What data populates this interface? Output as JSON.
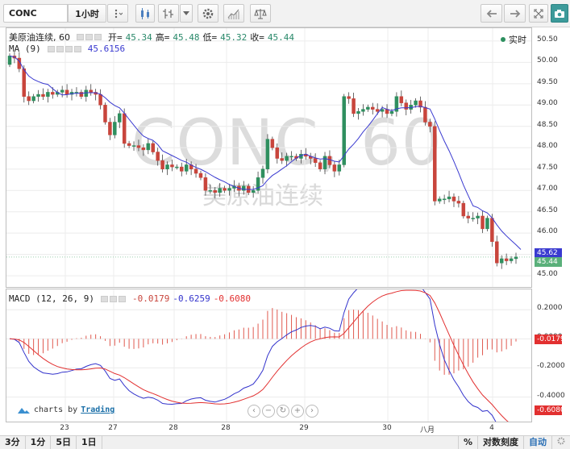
{
  "toolbar": {
    "symbol": "CONC",
    "interval": "1小时",
    "icons": [
      "menu-dots-icon",
      "candles-icon",
      "bar-style-icon",
      "settings-icon",
      "indicator-icon",
      "compare-icon",
      "undo-icon",
      "redo-icon",
      "fullscreen-icon",
      "camera-icon"
    ]
  },
  "legend": {
    "name": "美原油连续, 60",
    "open_label": "开=",
    "open": "45.34",
    "high_label": "高=",
    "high": "45.48",
    "low_label": "低=",
    "low": "45.32",
    "close_label": "收=",
    "close": "45.44",
    "ma_label": "MA (9)",
    "ma_value": "45.6156",
    "macd_label": "MACD (12, 26, 9)",
    "macd_hist": "-0.0179",
    "macd_line": "-0.6259",
    "macd_signal": "-0.6080"
  },
  "live_label": "实时",
  "watermark": {
    "main": "CONC, 60",
    "sub": "美原油连续"
  },
  "price_tags": {
    "ma": "45.62",
    "last": "45.44",
    "hist": "-0.0179",
    "signal": "-0.6080"
  },
  "credit": {
    "prefix": "charts by",
    "brand": "Trading"
  },
  "bottom": {
    "left": [
      "3分",
      "1分",
      "5日",
      "1日"
    ],
    "percent": "%",
    "log": "对数刻度",
    "auto": "自动"
  },
  "colors": {
    "up": "#2f8f5f",
    "down": "#c8453c",
    "ma": "#3a3ad0",
    "macd": "#3333cc",
    "signal": "#e23030"
  },
  "chart_data": [
    {
      "type": "candlestick",
      "name": "美原油连续, 60",
      "ylim": [
        44.7,
        50.8
      ],
      "y_ticks": [
        45.0,
        45.5,
        46.0,
        46.5,
        47.0,
        47.5,
        48.0,
        48.5,
        49.0,
        49.5,
        50.0,
        50.5
      ],
      "x_ticks": [
        "23",
        "27",
        "28",
        "28",
        "29",
        "30",
        "八月",
        "4"
      ],
      "closes": [
        50.15,
        50.1,
        49.85,
        49.2,
        49.1,
        49.2,
        49.25,
        49.2,
        49.3,
        49.25,
        49.3,
        49.35,
        49.25,
        49.3,
        49.3,
        49.2,
        49.35,
        49.3,
        49.25,
        49.0,
        48.6,
        48.3,
        48.6,
        48.8,
        48.1,
        48.05,
        48.05,
        48.0,
        47.95,
        48.1,
        47.9,
        47.7,
        47.5,
        47.6,
        47.55,
        47.55,
        47.45,
        47.6,
        47.5,
        47.4,
        47.3,
        47.0,
        47.0,
        46.95,
        47.05,
        47.0,
        47.05,
        47.1,
        47.0,
        47.1,
        46.95,
        47.0,
        47.3,
        47.5,
        48.2,
        48.0,
        47.75,
        47.7,
        47.8,
        47.8,
        47.75,
        47.85,
        47.8,
        47.75,
        47.65,
        47.5,
        47.8,
        47.6,
        47.45,
        47.6,
        49.2,
        49.15,
        48.8,
        48.85,
        48.9,
        48.95,
        48.9,
        48.85,
        48.9,
        48.8,
        48.85,
        49.2,
        49.05,
        48.9,
        49.0,
        49.1,
        48.95,
        48.6,
        48.5,
        46.75,
        46.8,
        46.8,
        46.85,
        46.75,
        46.7,
        46.4,
        46.35,
        46.35,
        46.4,
        46.1,
        46.35,
        45.8,
        45.3,
        45.4,
        45.35,
        45.4,
        45.44
      ],
      "ma9_last": 45.6156
    },
    {
      "type": "line",
      "name": "MACD (12, 26, 9)",
      "ylim": [
        -0.58,
        0.34
      ],
      "y_ticks": [
        0.2,
        0.0,
        -0.2,
        -0.4
      ],
      "series": [
        {
          "name": "macd",
          "last": -0.6259
        },
        {
          "name": "signal",
          "last": -0.608
        },
        {
          "name": "histogram",
          "last": -0.0179
        }
      ]
    }
  ]
}
